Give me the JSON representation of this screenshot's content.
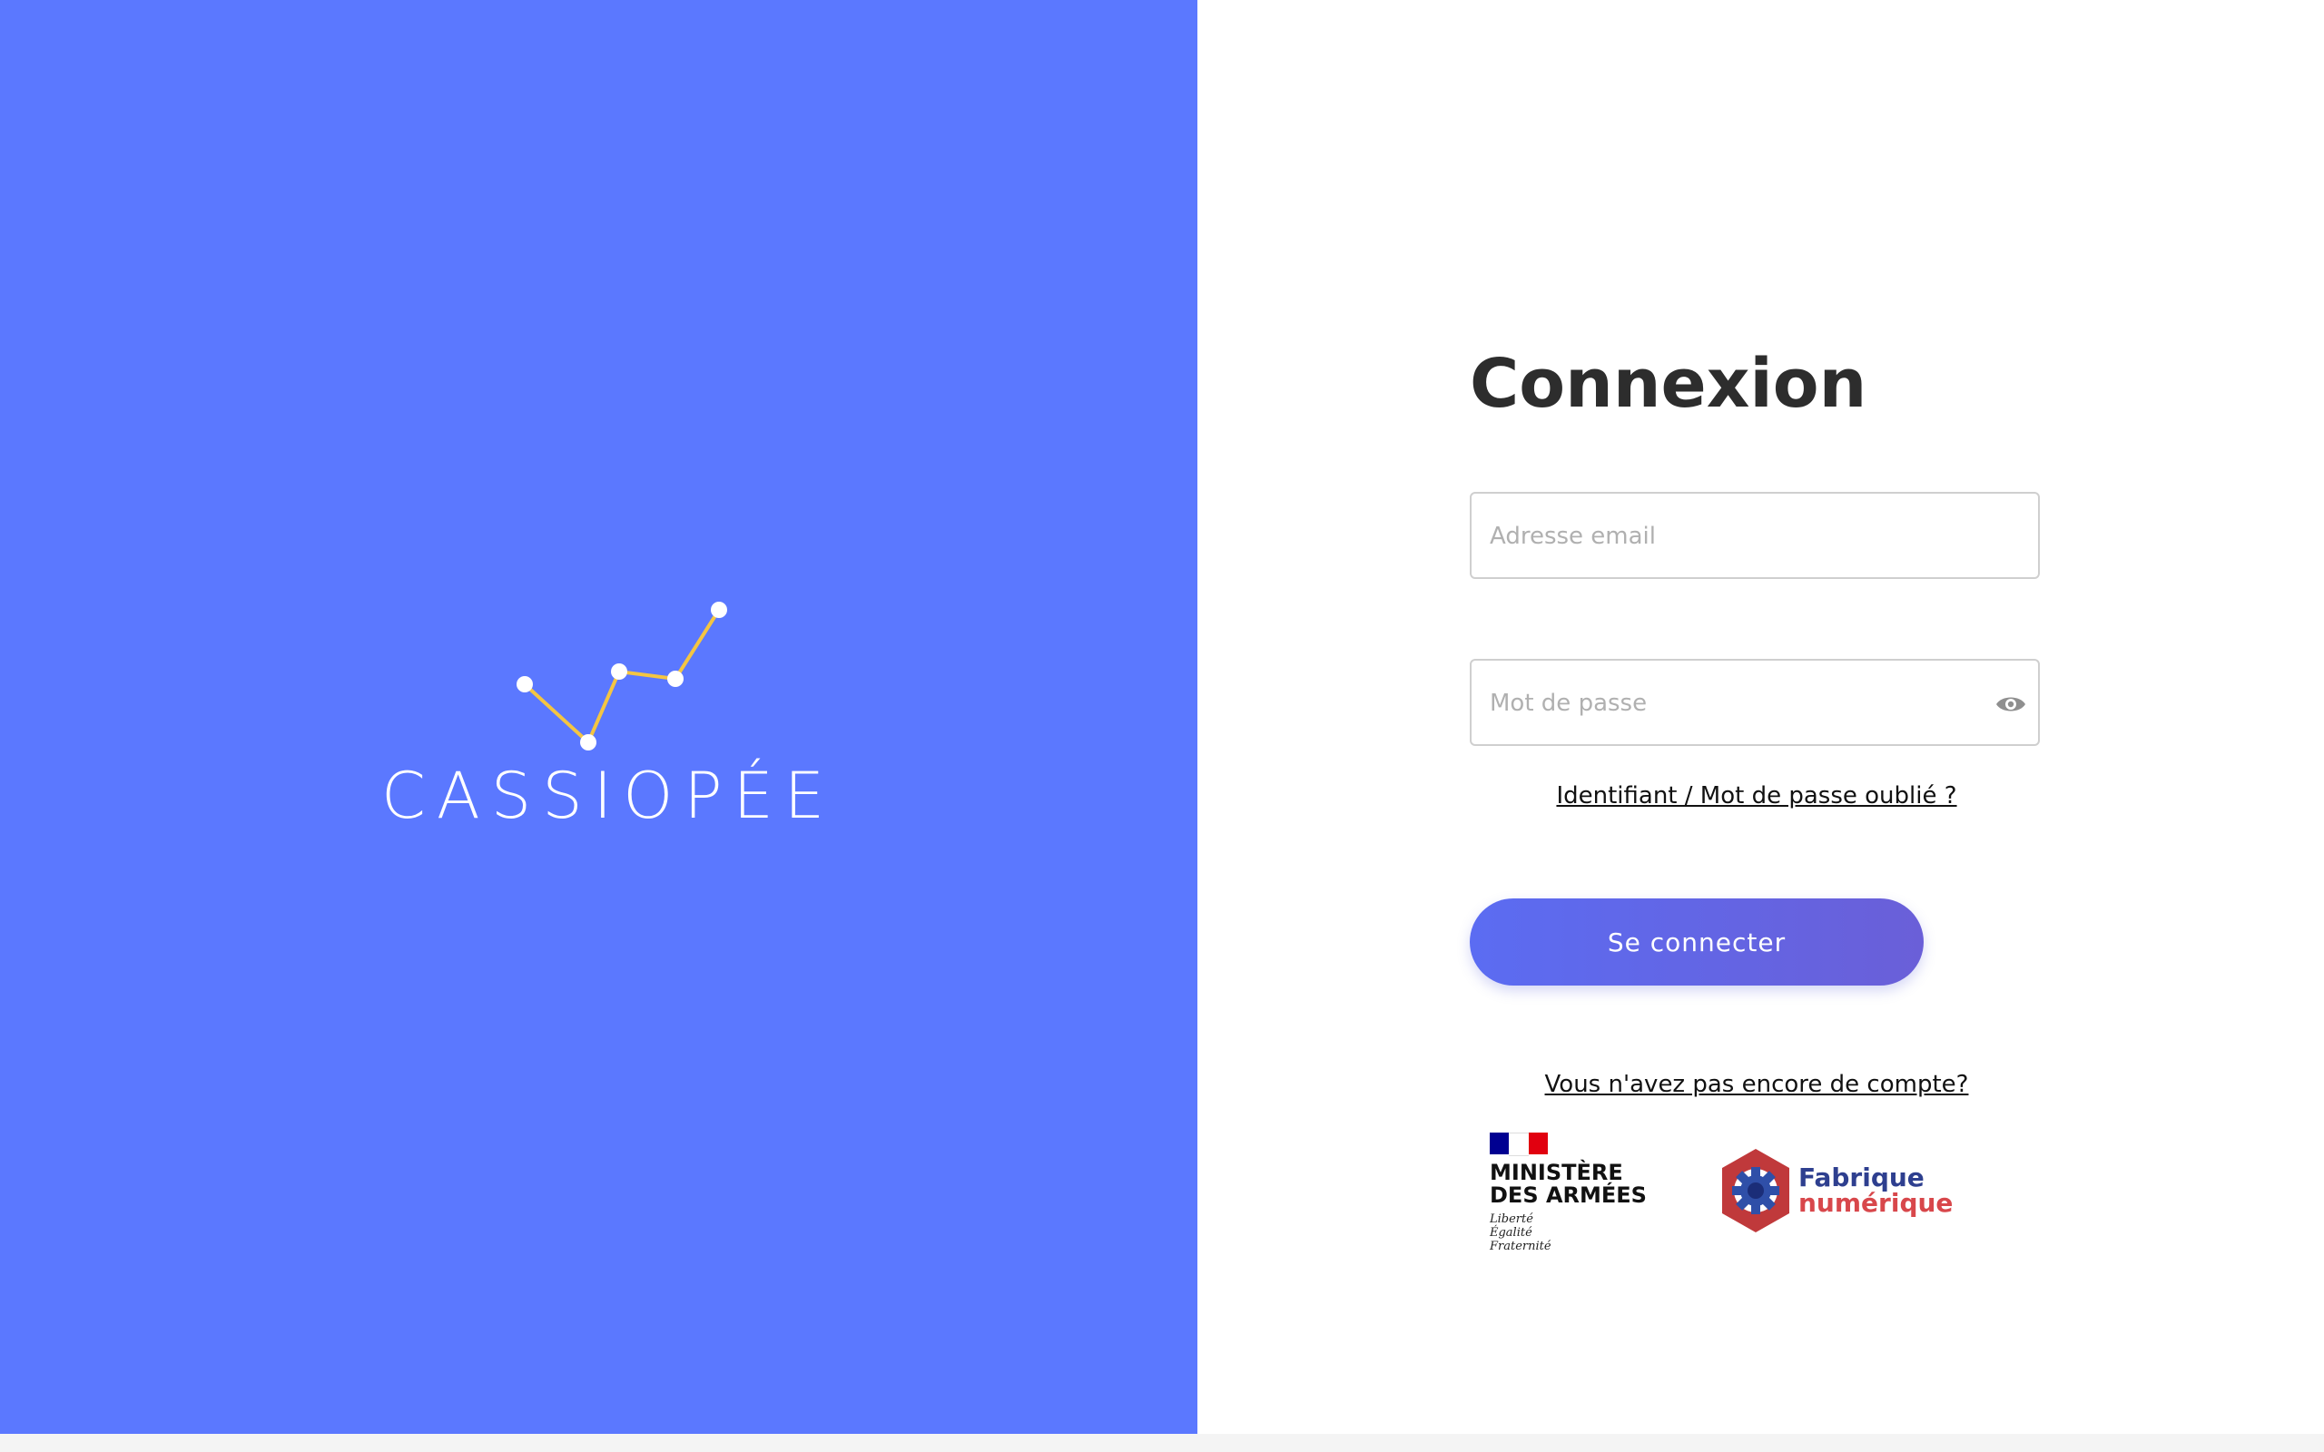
{
  "brand": {
    "name": "CASSIOPÉE",
    "colors": {
      "panel": "#5b78ff",
      "constellation_line": "#f4c542",
      "star": "#ffffff"
    }
  },
  "login": {
    "title": "Connexion",
    "email_placeholder": "Adresse email",
    "password_placeholder": "Mot de passe",
    "password_toggle_icon": "eye-icon",
    "forgot_link": "Identifiant / Mot de passe oublié ?",
    "submit_label": "Se connecter",
    "signup_link": "Vous n'avez pas encore de compte?",
    "colors": {
      "button_start": "#5b6cf2",
      "button_end": "#6a5fd8",
      "title": "#2d2d2d"
    }
  },
  "partners": {
    "ministere": {
      "title_line1": "MINISTÈRE",
      "title_line2": "DES ARMÉES",
      "motto": [
        "Liberté",
        "Égalité",
        "Fraternité"
      ],
      "flag_colors": [
        "#000091",
        "#ffffff",
        "#e1000f"
      ]
    },
    "fabrique": {
      "line1": "Fabrique",
      "line2": "numérique",
      "icon": "gear-icon",
      "colors": {
        "line1": "#2e3f8f",
        "line2": "#d8474b"
      }
    }
  }
}
